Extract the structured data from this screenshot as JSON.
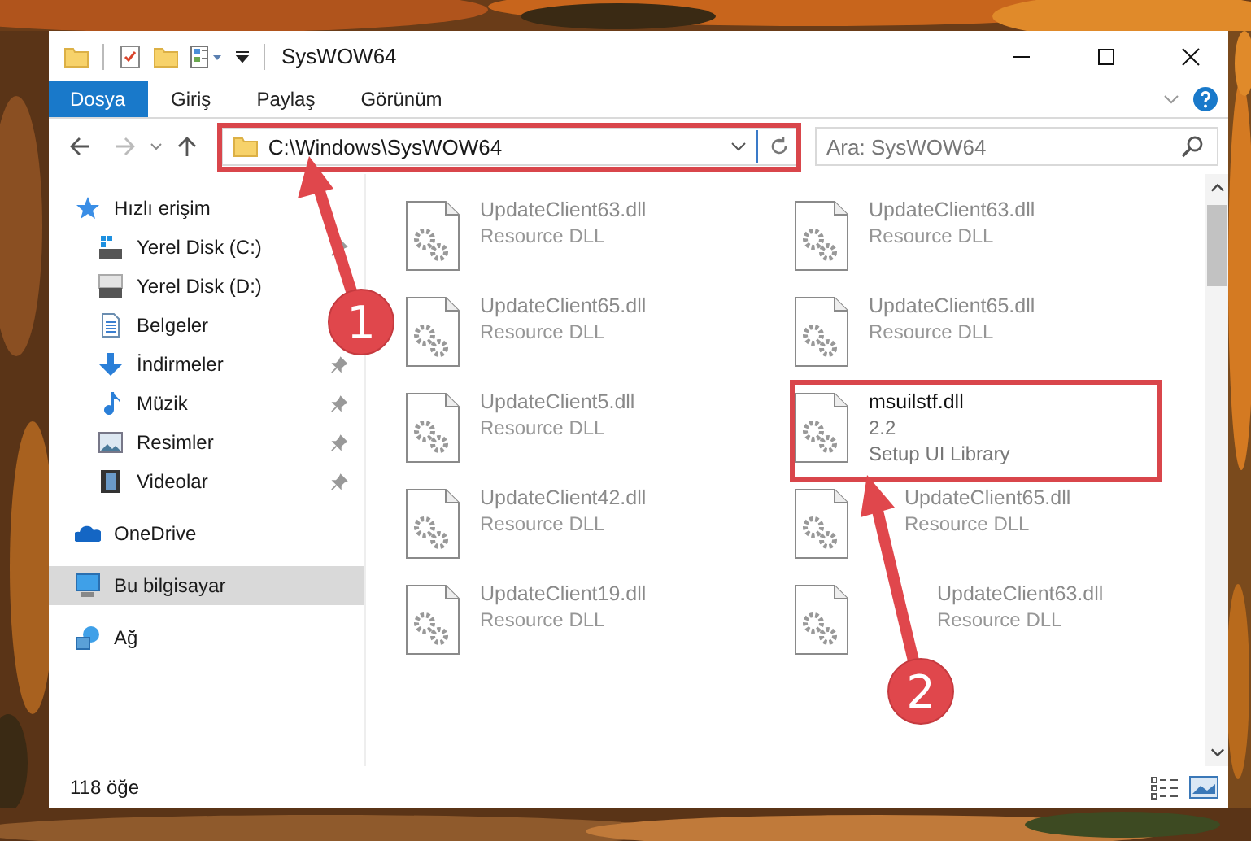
{
  "window": {
    "title": "SysWOW64"
  },
  "ribbon_tabs": [
    {
      "label": "Dosya",
      "selected": true
    },
    {
      "label": "Giriş",
      "selected": false
    },
    {
      "label": "Paylaş",
      "selected": false
    },
    {
      "label": "Görünüm",
      "selected": false
    }
  ],
  "address": {
    "path": "C:\\Windows\\SysWOW64"
  },
  "search": {
    "placeholder": "Ara: SysWOW64"
  },
  "sidebar": {
    "items": [
      {
        "label": "Hızlı erişim",
        "kind": "star",
        "selected": false,
        "children": [
          {
            "label": "Yerel Disk (C:)",
            "kind": "drive-c",
            "selected": false,
            "pinned": true
          },
          {
            "label": "Yerel Disk (D:)",
            "kind": "drive",
            "selected": false,
            "pinned": false
          },
          {
            "label": "Belgeler",
            "kind": "documents",
            "selected": false,
            "pinned": false
          },
          {
            "label": "İndirmeler",
            "kind": "download",
            "selected": false,
            "pinned": true
          },
          {
            "label": "Müzik",
            "kind": "music",
            "selected": false,
            "pinned": true
          },
          {
            "label": "Resimler",
            "kind": "pictures",
            "selected": false,
            "pinned": true
          },
          {
            "label": "Videolar",
            "kind": "videos",
            "selected": false,
            "pinned": true
          }
        ]
      },
      {
        "label": "OneDrive",
        "kind": "cloud",
        "selected": false
      },
      {
        "label": "Bu bilgisayar",
        "kind": "computer",
        "selected": true
      },
      {
        "label": "Ağ",
        "kind": "network",
        "selected": false
      }
    ]
  },
  "files": [
    {
      "name": "UpdateClient63.dll",
      "details": [
        "Resource DLL"
      ],
      "kind": "dimmed"
    },
    {
      "name": "UpdateClient63.dll",
      "details": [
        "Resource DLL"
      ],
      "kind": "dimmed"
    },
    {
      "name": "UpdateClient65.dll",
      "details": [
        "Resource DLL"
      ],
      "kind": "dimmed"
    },
    {
      "name": "UpdateClient65.dll",
      "details": [
        "Resource DLL"
      ],
      "kind": "dimmed"
    },
    {
      "name": "UpdateClient5.dll",
      "details": [
        "Resource DLL"
      ],
      "kind": "dimmed"
    },
    {
      "name": "msuilstf.dll",
      "details": [
        "2.2",
        "Setup UI Library"
      ],
      "kind": "plain"
    },
    {
      "name": "UpdateClient42.dll",
      "details": [
        "Resource DLL"
      ],
      "kind": "dimmed"
    },
    {
      "name": "UpdateClient65.dll",
      "details": [
        "Resource DLL"
      ],
      "kind": "dimmed-offset"
    },
    {
      "name": "UpdateClient19.dll",
      "details": [
        "Resource DLL"
      ],
      "kind": "dimmed"
    },
    {
      "name": "UpdateClient63.dll",
      "details": [
        "Resource DLL"
      ],
      "kind": "dimmed-wide-offset"
    }
  ],
  "status_bar": {
    "count": "118 öğe"
  },
  "annotations": [
    {
      "label": "1"
    },
    {
      "label": "2"
    }
  ]
}
